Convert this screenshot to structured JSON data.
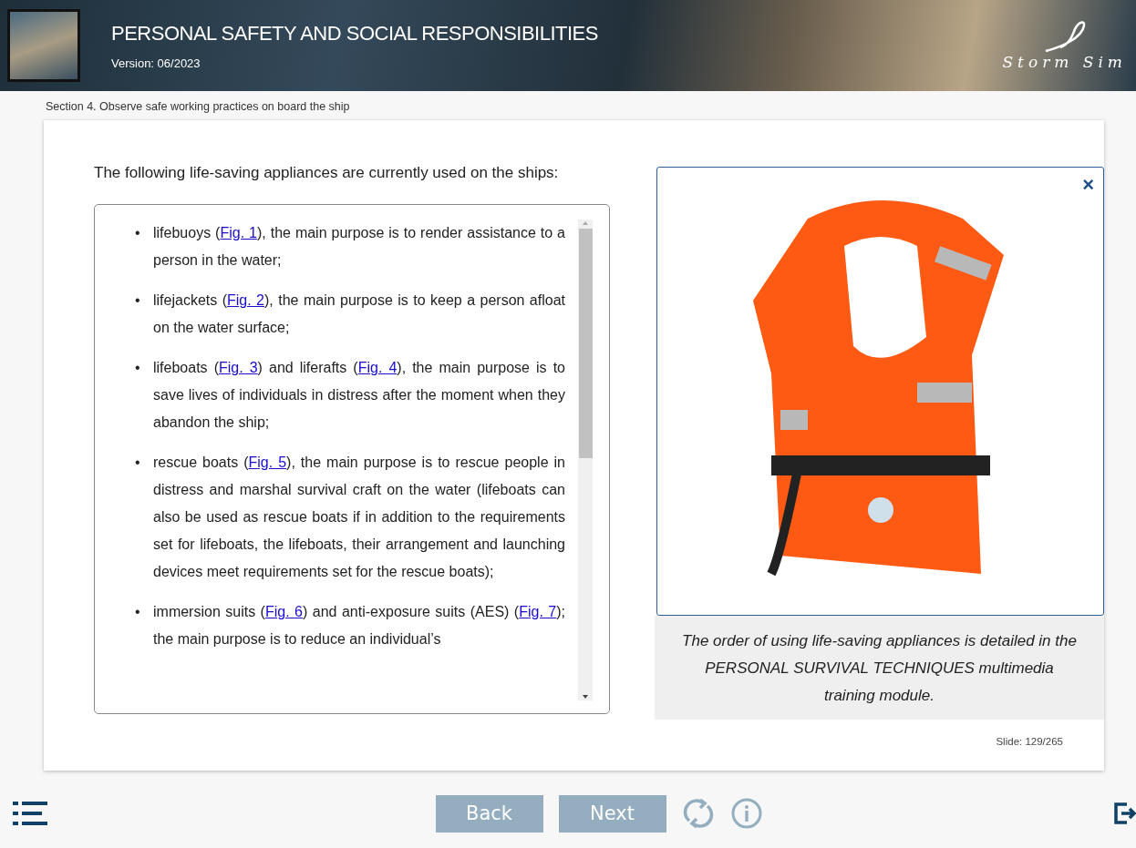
{
  "header": {
    "title": "PERSONAL SAFETY AND SOCIAL RESPONSIBILITIES",
    "version": "Version: 06/2023",
    "logo_text": "Storm Sim"
  },
  "section": "Section 4. Observe safe working practices on board the ship",
  "intro": "The following life-saving appliances are currently used on the ships:",
  "bullet": "•",
  "items": [
    [
      {
        "kind": "text",
        "text": "lifebuoys ("
      },
      {
        "kind": "link",
        "text": "Fig. 1"
      },
      {
        "kind": "text",
        "text": "), the main purpose is to render assistance to a person in the water;"
      }
    ],
    [
      {
        "kind": "text",
        "text": "lifejackets ("
      },
      {
        "kind": "link",
        "text": "Fig. 2"
      },
      {
        "kind": "text",
        "text": "), the main purpose is to keep a person afloat on the water surface;"
      }
    ],
    [
      {
        "kind": "text",
        "text": "lifeboats ("
      },
      {
        "kind": "link",
        "text": "Fig. 3"
      },
      {
        "kind": "text",
        "text": ") and liferafts ("
      },
      {
        "kind": "link",
        "text": "Fig. 4"
      },
      {
        "kind": "text",
        "text": "), the main purpose is to save lives of individuals in distress after the moment when they abandon the ship;"
      }
    ],
    [
      {
        "kind": "text",
        "text": "rescue boats ("
      },
      {
        "kind": "link",
        "text": "Fig. 5"
      },
      {
        "kind": "text",
        "text": "), the main purpose is to rescue people in distress and marshal survival craft on the water (lifeboats can also be used as rescue boats if in addition to the requirements set for lifeboats, the lifeboats, their arrangement and launching devices meet requirements set for the rescue boats);"
      }
    ],
    [
      {
        "kind": "text",
        "text": "immersion suits ("
      },
      {
        "kind": "link",
        "text": "Fig. 6"
      },
      {
        "kind": "text",
        "text": ") and anti-exposure suits (AES) ("
      },
      {
        "kind": "link",
        "text": "Fig. 7"
      },
      {
        "kind": "text",
        "text": "); the main purpose is to reduce an individual’s"
      }
    ]
  ],
  "popup": {
    "close": "×"
  },
  "caption": "The order of using life-saving appliances is detailed in the PERSONAL SURVIVAL TECHNIQUES multimedia training module.",
  "slide": "Slide:  129/265",
  "nav": {
    "back": "Back",
    "next": "Next"
  }
}
